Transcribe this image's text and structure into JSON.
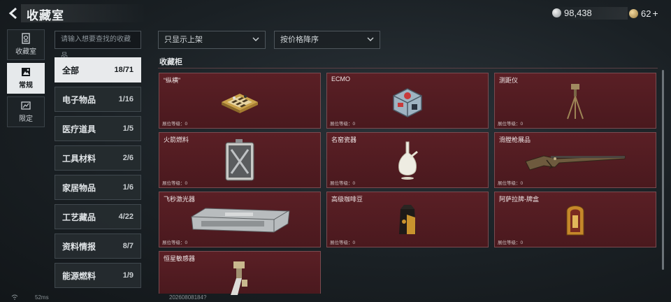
{
  "header": {
    "title": "收藏室",
    "currency_silver": "98,438",
    "currency_gold": "62",
    "currency_gold_plus": "+"
  },
  "nav": [
    {
      "label": "收藏室",
      "icon": "collection-room-icon"
    },
    {
      "label": "常规",
      "icon": "regular-icon",
      "active": true
    },
    {
      "label": "限定",
      "icon": "limited-icon"
    }
  ],
  "search": {
    "placeholder": "请输入想要查找的收藏品"
  },
  "filters": {
    "shelf": "只显示上架",
    "sort": "按价格降序"
  },
  "categories": [
    {
      "label": "全部",
      "count": "18/71"
    },
    {
      "label": "电子物品",
      "count": "1/16"
    },
    {
      "label": "医疗道具",
      "count": "1/5"
    },
    {
      "label": "工具材料",
      "count": "2/6"
    },
    {
      "label": "家居物品",
      "count": "1/6"
    },
    {
      "label": "工艺藏品",
      "count": "4/22"
    },
    {
      "label": "资料情报",
      "count": "8/7"
    },
    {
      "label": "能源燃料",
      "count": "1/9"
    }
  ],
  "section": {
    "label": "收藏柜"
  },
  "items": [
    {
      "name": "“纵横”",
      "level": "展位等级：0",
      "icon": "chessboard-icon"
    },
    {
      "name": "ECMO",
      "level": "展位等级：0",
      "icon": "ecmo-machine-icon"
    },
    {
      "name": "测距仪",
      "level": "展位等级：0",
      "icon": "rangefinder-tripod-icon"
    },
    {
      "name": "火箭燃料",
      "level": "展位等级：0",
      "icon": "fuel-canister-icon"
    },
    {
      "name": "名窑瓷器",
      "level": "展位等级：0",
      "icon": "porcelain-vase-icon"
    },
    {
      "name": "滑膛枪展品",
      "level": "展位等级：0",
      "icon": "musket-icon"
    },
    {
      "name": "飞秒激光器",
      "level": "展位等级：0",
      "icon": "laser-device-icon"
    },
    {
      "name": "高级咖啡豆",
      "level": "展位等级：0",
      "icon": "coffee-bag-icon"
    },
    {
      "name": "阿萨拉牌-牌盒",
      "level": "展位等级：0",
      "icon": "card-box-icon"
    },
    {
      "name": "恒星敏感器",
      "level": "",
      "icon": "star-sensor-icon"
    }
  ],
  "status": {
    "ping": "52ms",
    "build": "20260808184?"
  }
}
